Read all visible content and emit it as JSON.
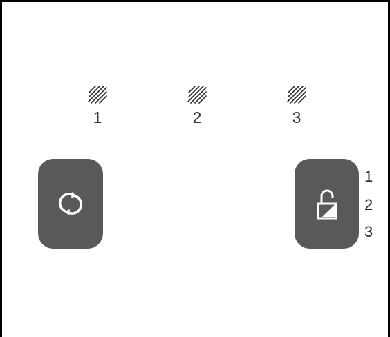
{
  "indicators": [
    {
      "label": "1",
      "icon": "hatched-square-icon"
    },
    {
      "label": "2",
      "icon": "hatched-square-icon"
    },
    {
      "label": "3",
      "icon": "hatched-square-icon"
    }
  ],
  "buttons": {
    "sync": {
      "icon": "sync-icon"
    },
    "lock": {
      "icon": "unlock-icon"
    }
  },
  "lock_options": [
    "1",
    "2",
    "3"
  ],
  "colors": {
    "button_bg": "#595959",
    "icon": "#ffffff",
    "frame": "#000000",
    "hatch": "#2a2a2a"
  }
}
